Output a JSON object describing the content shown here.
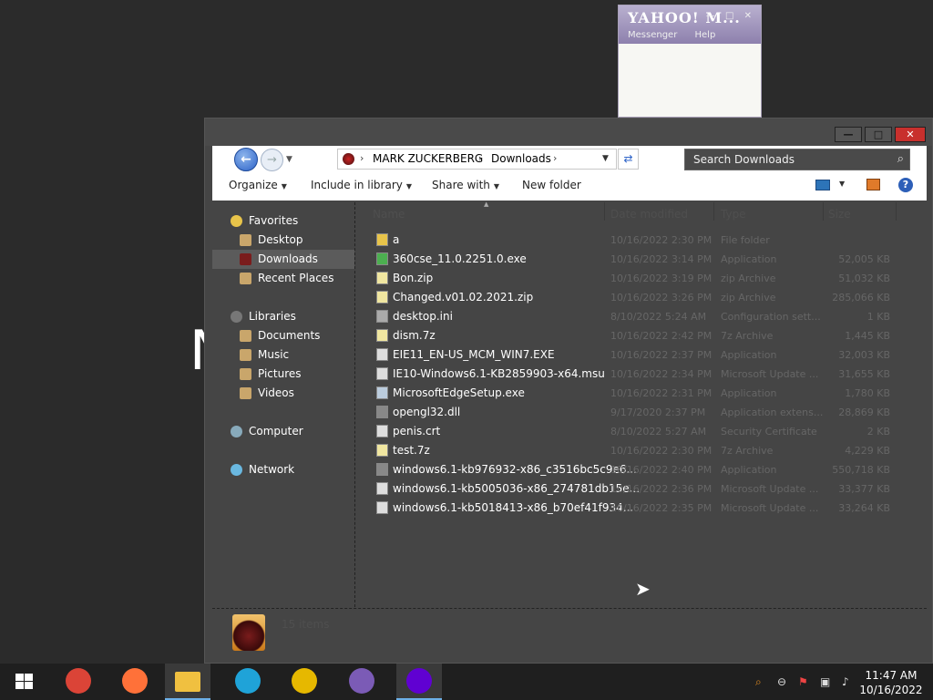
{
  "desktop": {
    "partial_text": "N"
  },
  "yahoo": {
    "logo": "YAHOO! M...",
    "menu": [
      "Messenger",
      "Help"
    ]
  },
  "explorer": {
    "window_controls": {
      "minimize": "—",
      "maximize": "□",
      "close": "✕"
    },
    "breadcrumb": [
      "MARK ZUCKERBERG",
      "Downloads"
    ],
    "search_placeholder": "Search Downloads",
    "toolbar": {
      "organize": "Organize",
      "include_in_library": "Include in library",
      "share_with": "Share with",
      "new_folder": "New folder"
    },
    "nav": [
      {
        "label": "Favorites",
        "icon": "star-icon",
        "indent": 0,
        "color": "#e8c44a"
      },
      {
        "label": "Desktop",
        "icon": "desktop-icon",
        "indent": 1,
        "color": "#c9a66b"
      },
      {
        "label": "Downloads",
        "icon": "downloads-icon",
        "indent": 1,
        "color": "#7a1c1c",
        "selected": true
      },
      {
        "label": "Recent Places",
        "icon": "recent-places-icon",
        "indent": 1,
        "color": "#c9a66b"
      },
      {
        "label": "Libraries",
        "icon": "libraries-icon",
        "indent": 0,
        "color": "#777"
      },
      {
        "label": "Documents",
        "icon": "documents-icon",
        "indent": 1,
        "color": "#c9a66b"
      },
      {
        "label": "Music",
        "icon": "music-icon",
        "indent": 1,
        "color": "#c9a66b"
      },
      {
        "label": "Pictures",
        "icon": "pictures-icon",
        "indent": 1,
        "color": "#c9a66b"
      },
      {
        "label": "Videos",
        "icon": "videos-icon",
        "indent": 1,
        "color": "#c9a66b"
      },
      {
        "label": "Computer",
        "icon": "computer-icon",
        "indent": 0,
        "color": "#8ab"
      },
      {
        "label": "Network",
        "icon": "network-icon",
        "indent": 0,
        "color": "#6ab8e0"
      }
    ],
    "columns": [
      "Name",
      "Date modified",
      "Type",
      "Size"
    ],
    "files": [
      {
        "name": "a",
        "date": "10/16/2022 2:30 PM",
        "type": "File folder",
        "size": "",
        "icon": "folder-icon",
        "color": "#e8c44a"
      },
      {
        "name": "360cse_11.0.2251.0.exe",
        "date": "10/16/2022 3:14 PM",
        "type": "Application",
        "size": "52,005 KB",
        "icon": "exe-icon",
        "color": "#4caf50"
      },
      {
        "name": "Bon.zip",
        "date": "10/16/2022 3:19 PM",
        "type": "zip Archive",
        "size": "51,032 KB",
        "icon": "zip-icon",
        "color": "#f0e6a0"
      },
      {
        "name": "Changed.v01.02.2021.zip",
        "date": "10/16/2022 3:26 PM",
        "type": "zip Archive",
        "size": "285,066 KB",
        "icon": "zip-icon",
        "color": "#f0e6a0"
      },
      {
        "name": "desktop.ini",
        "date": "8/10/2022 5:24 AM",
        "type": "Configuration sett...",
        "size": "1 KB",
        "icon": "ini-icon",
        "color": "#aaa"
      },
      {
        "name": "dism.7z",
        "date": "10/16/2022 2:42 PM",
        "type": "7z Archive",
        "size": "1,445 KB",
        "icon": "7z-icon",
        "color": "#f0e6a0"
      },
      {
        "name": "EIE11_EN-US_MCM_WIN7.EXE",
        "date": "10/16/2022 2:37 PM",
        "type": "Application",
        "size": "32,003 KB",
        "icon": "exe-icon",
        "color": "#ddd"
      },
      {
        "name": "IE10-Windows6.1-KB2859903-x64.msu",
        "date": "10/16/2022 2:34 PM",
        "type": "Microsoft Update ...",
        "size": "31,655 KB",
        "icon": "msu-icon",
        "color": "#ddd"
      },
      {
        "name": "MicrosoftEdgeSetup.exe",
        "date": "10/16/2022 2:31 PM",
        "type": "Application",
        "size": "1,780 KB",
        "icon": "exe-icon",
        "color": "#bcd"
      },
      {
        "name": "opengl32.dll",
        "date": "9/17/2020 2:37 PM",
        "type": "Application extens...",
        "size": "28,869 KB",
        "icon": "dll-icon",
        "color": "#888"
      },
      {
        "name": "penis.crt",
        "date": "8/10/2022 5:27 AM",
        "type": "Security Certificate",
        "size": "2 KB",
        "icon": "certificate-icon",
        "color": "#ddd"
      },
      {
        "name": "test.7z",
        "date": "10/16/2022 2:30 PM",
        "type": "7z Archive",
        "size": "4,229 KB",
        "icon": "7z-icon",
        "color": "#f0e6a0"
      },
      {
        "name": "windows6.1-kb976932-x86_c3516bc5c9e6...",
        "date": "10/16/2022 2:40 PM",
        "type": "Application",
        "size": "550,718 KB",
        "icon": "exe-icon",
        "color": "#888"
      },
      {
        "name": "windows6.1-kb5005036-x86_274781db15e...",
        "date": "10/16/2022 2:36 PM",
        "type": "Microsoft Update ...",
        "size": "33,377 KB",
        "icon": "msu-icon",
        "color": "#ddd"
      },
      {
        "name": "windows6.1-kb5018413-x86_b70ef41f934...",
        "date": "10/16/2022 2:35 PM",
        "type": "Microsoft Update ...",
        "size": "33,264 KB",
        "icon": "msu-icon",
        "color": "#ddd"
      }
    ],
    "details_text": "15 items"
  },
  "taskbar": {
    "apps": [
      {
        "name": "chrome",
        "color": "#db4437"
      },
      {
        "name": "firefox",
        "color": "#ff7139"
      },
      {
        "name": "file-explorer",
        "color": "#f0c040",
        "active": true
      },
      {
        "name": "edge",
        "color": "#1fa3d8"
      },
      {
        "name": "colorful-app",
        "color": "#e6b800"
      },
      {
        "name": "bonzi",
        "color": "#7b5bb6"
      },
      {
        "name": "yahoo-messenger",
        "color": "#6001d2",
        "active": true
      }
    ],
    "time": "11:47 AM",
    "date": "10/16/2022"
  }
}
